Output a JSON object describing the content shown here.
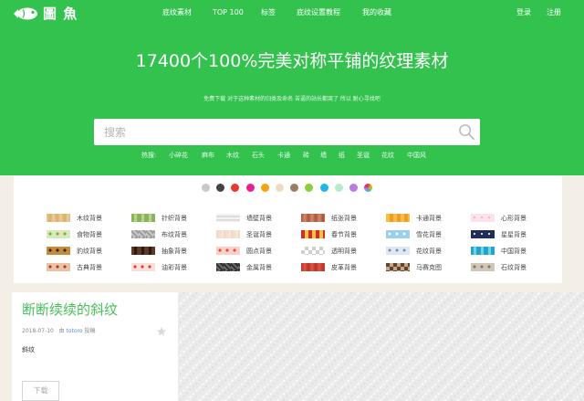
{
  "site": {
    "logo_text": "圖 魚",
    "logo_icon": "fish-icon",
    "brand_color": "#33c24e"
  },
  "nav": {
    "items": [
      "底纹素材",
      "TOP 100",
      "标签",
      "底纹设置教程",
      "我的收藏"
    ],
    "login": "登录",
    "register": "注册"
  },
  "hero": {
    "title": "17400个100%完美对称平铺的纹理素材",
    "subtitle": "免费下载 对于这种素材的归类及命名 苦逼的站长都哭了 所以 耐心寻找吧"
  },
  "search": {
    "placeholder": "搜索",
    "icon": "search-icon"
  },
  "hot": {
    "label": "热搜:",
    "tags": [
      "小碎花",
      "麻布",
      "木纹",
      "石头",
      "卡通",
      "砖",
      "墙",
      "纸",
      "圣诞",
      "花纹",
      "中国风"
    ]
  },
  "colors": [
    "#c8c8c8",
    "#444444",
    "#e53a2c",
    "#e81f8f",
    "#f5a313",
    "#ecdcc1",
    "#9a7f65",
    "#8ccf3a",
    "#1fb5ea",
    "#b6eccd",
    "#b87ce5",
    "rainbow"
  ],
  "categories": [
    [
      "木纹背景",
      "针织背景",
      "墙壁背景",
      "纸张背景",
      "卡通背景",
      "心形背景"
    ],
    [
      "食物背景",
      "布纹背景",
      "圣诞背景",
      "春节背景",
      "雪花背景",
      "星星背景"
    ],
    [
      "豹纹背景",
      "抽象背景",
      "圆点背景",
      "透明背景",
      "花纹背景",
      "中国背景"
    ],
    [
      "古典背景",
      "油彩背景",
      "金属背景",
      "皮革背景",
      "马赛克图",
      "石纹背景"
    ]
  ],
  "post": {
    "title": "断断续续的斜纹",
    "date": "2018-07-10",
    "author": "totoro",
    "author_prefix": "由",
    "author_suffix": "投稿",
    "tag": "斜纹",
    "download": "下载",
    "favorite_icon": "star-icon"
  }
}
